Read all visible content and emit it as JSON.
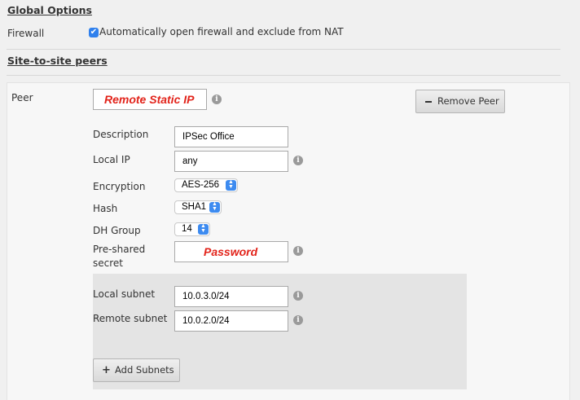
{
  "global_options": {
    "title": "Global Options",
    "firewall_label": "Firewall",
    "firewall_checkbox_checked": true,
    "firewall_checkbox_label": "Automatically open firewall and exclude from NAT"
  },
  "site_to_site": {
    "title": "Site-to-site peers"
  },
  "peer": {
    "label": "Peer",
    "value": "Remote Static IP",
    "remove_button": "Remove Peer",
    "remove_icon": "minus-icon",
    "description_label": "Description",
    "description_value": "IPSec Office",
    "local_ip_label": "Local IP",
    "local_ip_value": "any",
    "encryption_label": "Encryption",
    "encryption_value": "AES-256",
    "hash_label": "Hash",
    "hash_value": "SHA1",
    "dh_group_label": "DH Group",
    "dh_group_value": "14",
    "psk_label_line1": "Pre-shared",
    "psk_label_line2": "secret",
    "psk_value": "Password",
    "local_subnet_label": "Local subnet",
    "local_subnet_value": "10.0.3.0/24",
    "remote_subnet_label": "Remote subnet",
    "remote_subnet_value": "10.0.2.0/24",
    "add_subnets_button": "Add Subnets",
    "add_icon": "plus-icon"
  },
  "colors": {
    "accent": "#2f80ed",
    "select_arrow": "#3d8bf0",
    "redacted_text": "#e2231a",
    "panel_bg": "#f7f7f7",
    "subnet_panel_bg": "#e4e4e4"
  }
}
